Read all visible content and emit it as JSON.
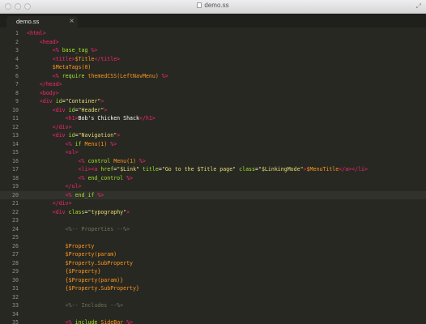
{
  "window": {
    "title": "demo.ss",
    "fullscreen_glyph": "⤢"
  },
  "tabs": [
    {
      "label": "demo.ss",
      "close": "×"
    }
  ],
  "editor": {
    "active_line": 20,
    "lines": [
      {
        "n": "1",
        "segs": [
          [
            "t",
            "<html>"
          ]
        ]
      },
      {
        "n": "2",
        "segs": [
          [
            "w",
            "    "
          ],
          [
            "t",
            "<head>"
          ]
        ]
      },
      {
        "n": "3",
        "segs": [
          [
            "w",
            "        "
          ],
          [
            "t",
            "<% "
          ],
          [
            "a",
            "base_tag"
          ],
          [
            "t",
            " %>"
          ]
        ]
      },
      {
        "n": "4",
        "segs": [
          [
            "w",
            "        "
          ],
          [
            "t",
            "<title>"
          ],
          [
            "v",
            "$Title"
          ],
          [
            "t",
            "</title>"
          ]
        ]
      },
      {
        "n": "5",
        "segs": [
          [
            "w",
            "        "
          ],
          [
            "v",
            "$MetaTags(0)"
          ]
        ]
      },
      {
        "n": "6",
        "segs": [
          [
            "w",
            "        "
          ],
          [
            "t",
            "<% "
          ],
          [
            "a",
            "require"
          ],
          [
            "w",
            " "
          ],
          [
            "v",
            "themedCSS(LeftNavMenu)"
          ],
          [
            "t",
            " %>"
          ]
        ]
      },
      {
        "n": "7",
        "segs": [
          [
            "w",
            "    "
          ],
          [
            "t",
            "</head>"
          ]
        ]
      },
      {
        "n": "8",
        "segs": [
          [
            "w",
            "    "
          ],
          [
            "t",
            "<body>"
          ]
        ]
      },
      {
        "n": "9",
        "segs": [
          [
            "w",
            "    "
          ],
          [
            "t",
            "<div"
          ],
          [
            "w",
            " "
          ],
          [
            "a",
            "id"
          ],
          [
            "w",
            "="
          ],
          [
            "s",
            "\"Container\""
          ],
          [
            "t",
            ">"
          ]
        ]
      },
      {
        "n": "10",
        "segs": [
          [
            "w",
            "        "
          ],
          [
            "t",
            "<div"
          ],
          [
            "w",
            " "
          ],
          [
            "a",
            "id"
          ],
          [
            "w",
            "="
          ],
          [
            "s",
            "\"Header\""
          ],
          [
            "t",
            ">"
          ]
        ]
      },
      {
        "n": "11",
        "segs": [
          [
            "w",
            "            "
          ],
          [
            "t",
            "<h1>"
          ],
          [
            "w",
            "Bob's Chicken Shack"
          ],
          [
            "t",
            "</h1>"
          ]
        ]
      },
      {
        "n": "12",
        "segs": [
          [
            "w",
            "        "
          ],
          [
            "t",
            "</div>"
          ]
        ]
      },
      {
        "n": "13",
        "segs": [
          [
            "w",
            "        "
          ],
          [
            "t",
            "<div"
          ],
          [
            "w",
            " "
          ],
          [
            "a",
            "id"
          ],
          [
            "w",
            "="
          ],
          [
            "s",
            "\"Navigation\""
          ],
          [
            "t",
            ">"
          ]
        ]
      },
      {
        "n": "14",
        "segs": [
          [
            "w",
            "            "
          ],
          [
            "t",
            "<% "
          ],
          [
            "a",
            "if"
          ],
          [
            "w",
            " "
          ],
          [
            "v",
            "Menu(1)"
          ],
          [
            "t",
            " %>"
          ]
        ]
      },
      {
        "n": "15",
        "segs": [
          [
            "w",
            "            "
          ],
          [
            "t",
            "<ul>"
          ]
        ]
      },
      {
        "n": "16",
        "segs": [
          [
            "w",
            "                "
          ],
          [
            "t",
            "<% "
          ],
          [
            "a",
            "control"
          ],
          [
            "w",
            " "
          ],
          [
            "v",
            "Menu(1)"
          ],
          [
            "t",
            " %>"
          ]
        ]
      },
      {
        "n": "17",
        "segs": [
          [
            "w",
            "                "
          ],
          [
            "t",
            "<li><a"
          ],
          [
            "w",
            " "
          ],
          [
            "a",
            "href"
          ],
          [
            "w",
            "="
          ],
          [
            "s",
            "\"$Link\""
          ],
          [
            "w",
            " "
          ],
          [
            "a",
            "title"
          ],
          [
            "w",
            "="
          ],
          [
            "s",
            "\"Go to the $Title page\""
          ],
          [
            "w",
            " "
          ],
          [
            "a",
            "class"
          ],
          [
            "w",
            "="
          ],
          [
            "s",
            "\"$LinkingMode\""
          ],
          [
            "t",
            ">"
          ],
          [
            "v",
            "$MenuTitle"
          ],
          [
            "t",
            "</a></li>"
          ]
        ]
      },
      {
        "n": "18",
        "segs": [
          [
            "w",
            "                "
          ],
          [
            "t",
            "<% "
          ],
          [
            "a",
            "end_control"
          ],
          [
            "t",
            " %>"
          ]
        ]
      },
      {
        "n": "19",
        "segs": [
          [
            "w",
            "            "
          ],
          [
            "t",
            "</ul>"
          ]
        ]
      },
      {
        "n": "20",
        "segs": [
          [
            "w",
            "            "
          ],
          [
            "t",
            "<% "
          ],
          [
            "a",
            "end_if"
          ],
          [
            "t",
            " %>"
          ]
        ]
      },
      {
        "n": "21",
        "segs": [
          [
            "w",
            "        "
          ],
          [
            "t",
            "</div>"
          ]
        ]
      },
      {
        "n": "22",
        "segs": [
          [
            "w",
            "        "
          ],
          [
            "t",
            "<div"
          ],
          [
            "w",
            " "
          ],
          [
            "a",
            "class"
          ],
          [
            "w",
            "="
          ],
          [
            "s",
            "\"typography\""
          ],
          [
            "t",
            ">"
          ]
        ]
      },
      {
        "n": "23",
        "segs": []
      },
      {
        "n": "24",
        "segs": [
          [
            "w",
            "            "
          ],
          [
            "c",
            "<%-- Properties --%>"
          ]
        ]
      },
      {
        "n": "25",
        "segs": []
      },
      {
        "n": "26",
        "segs": [
          [
            "w",
            "            "
          ],
          [
            "v",
            "$Property"
          ]
        ]
      },
      {
        "n": "27",
        "segs": [
          [
            "w",
            "            "
          ],
          [
            "v",
            "$Property(param)"
          ]
        ]
      },
      {
        "n": "28",
        "segs": [
          [
            "w",
            "            "
          ],
          [
            "v",
            "$Property.SubProperty"
          ]
        ]
      },
      {
        "n": "29",
        "segs": [
          [
            "w",
            "            "
          ],
          [
            "v",
            "{$Property}"
          ]
        ]
      },
      {
        "n": "30",
        "segs": [
          [
            "w",
            "            "
          ],
          [
            "v",
            "{$Property(param)}"
          ]
        ]
      },
      {
        "n": "31",
        "segs": [
          [
            "w",
            "            "
          ],
          [
            "v",
            "{$Property.SubProperty}"
          ]
        ]
      },
      {
        "n": "32",
        "segs": []
      },
      {
        "n": "33",
        "segs": [
          [
            "w",
            "            "
          ],
          [
            "c",
            "<%-- Includes --%>"
          ]
        ]
      },
      {
        "n": "34",
        "segs": []
      },
      {
        "n": "35",
        "segs": [
          [
            "w",
            "            "
          ],
          [
            "t",
            "<% "
          ],
          [
            "a",
            "include"
          ],
          [
            "w",
            " "
          ],
          [
            "v",
            "SideBar"
          ],
          [
            "t",
            " %>"
          ]
        ]
      }
    ]
  }
}
